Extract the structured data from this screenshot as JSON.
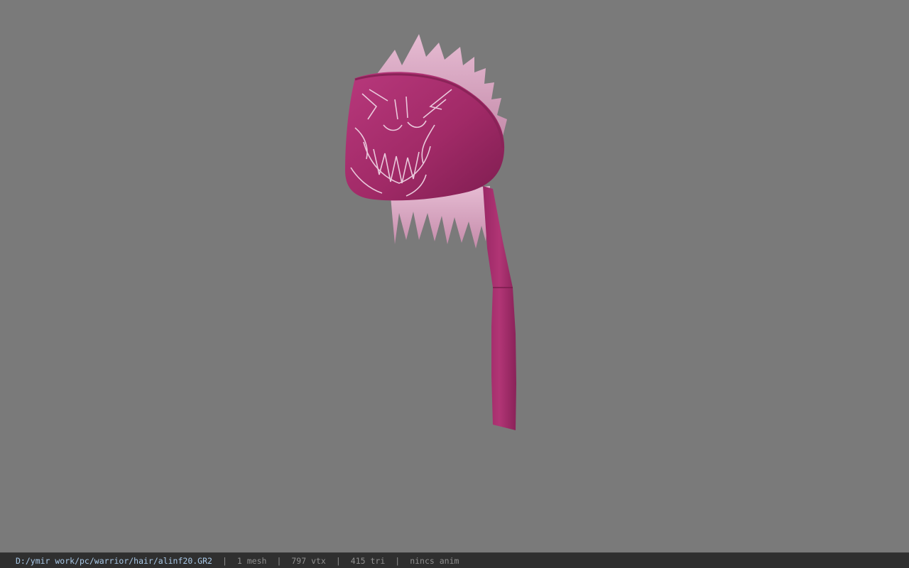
{
  "viewer": {
    "model_description": "pink bandana hair model with spiky light pink hair and a hanging cloth tail"
  },
  "status": {
    "path": "D:/ymir work/pc/warrior/hair/alinf20.GR2",
    "separator": "|",
    "mesh": "1 mesh",
    "vertices": "797 vtx",
    "triangles": "415 tri",
    "animation": "nincs anim"
  },
  "colors": {
    "background": "#7a7a7a",
    "bandana": "#a8306e",
    "hair": "#d9a8c4",
    "statusbar": "#2f2f2f",
    "path_text": "#a9c9e8"
  }
}
